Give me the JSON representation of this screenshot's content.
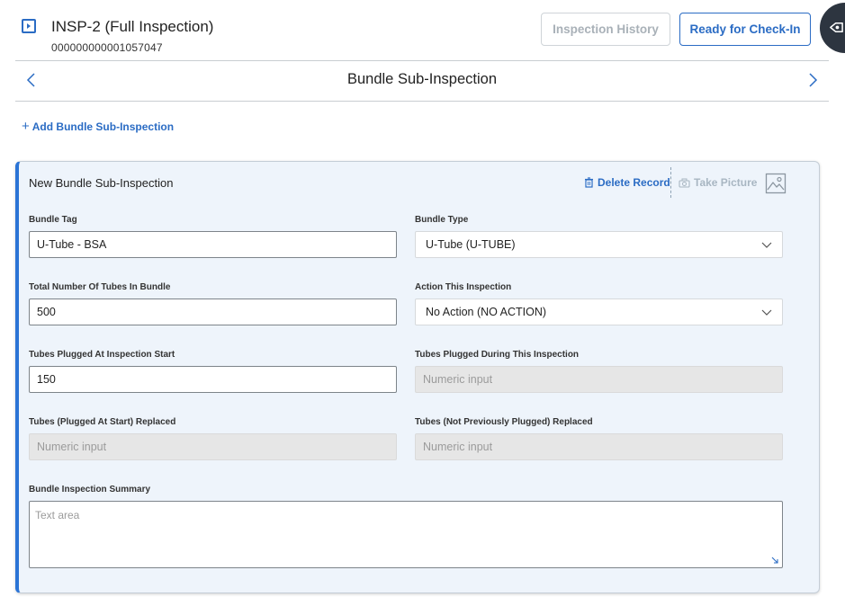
{
  "header": {
    "title": "INSP-2 (Full Inspection)",
    "subtitle": "000000000001057047",
    "buttons": {
      "inspection_history": "Inspection History",
      "ready_for_checkin": "Ready for Check-In"
    }
  },
  "nav": {
    "title": "Bundle Sub-Inspection"
  },
  "actions": {
    "add_bundle": "Add Bundle Sub-Inspection"
  },
  "card": {
    "title": "New Bundle Sub-Inspection",
    "delete_record": "Delete Record",
    "take_picture": "Take Picture",
    "fields": {
      "bundle_tag": {
        "label": "Bundle Tag",
        "value": "U-Tube - BSA"
      },
      "bundle_type": {
        "label": "Bundle Type",
        "value": "U-Tube (U-TUBE)"
      },
      "total_tubes": {
        "label": "Total Number Of Tubes In Bundle",
        "value": "500"
      },
      "action_this_inspection": {
        "label": "Action This Inspection",
        "value": "No Action (NO ACTION)"
      },
      "tubes_plugged_start": {
        "label": "Tubes Plugged At Inspection Start",
        "value": "150"
      },
      "tubes_plugged_during": {
        "label": "Tubes Plugged During This Inspection",
        "placeholder": "Numeric input"
      },
      "tubes_plugged_start_replaced": {
        "label": "Tubes (Plugged At Start) Replaced",
        "placeholder": "Numeric input"
      },
      "tubes_not_plugged_replaced": {
        "label": "Tubes (Not Previously Plugged) Replaced",
        "placeholder": "Numeric input"
      },
      "summary": {
        "label": "Bundle Inspection Summary",
        "placeholder": "Text area"
      }
    }
  },
  "colors": {
    "accent": "#2b6cc4",
    "card_background": "#eef4fb",
    "card_accent_border": "#2b74d6",
    "disabled_field": "#e6e6e6",
    "side_tab": "#2d3540"
  },
  "icons": {
    "panel_toggle": "panel-toggle-icon",
    "side_tab": "eye-arrow-icon",
    "prev": "chevron-left-icon",
    "next": "chevron-right-icon",
    "add": "plus-icon",
    "delete": "trash-icon",
    "camera": "camera-icon",
    "image": "image-icon",
    "dropdown": "chevron-down-icon",
    "resize": "resize-handle-icon"
  }
}
